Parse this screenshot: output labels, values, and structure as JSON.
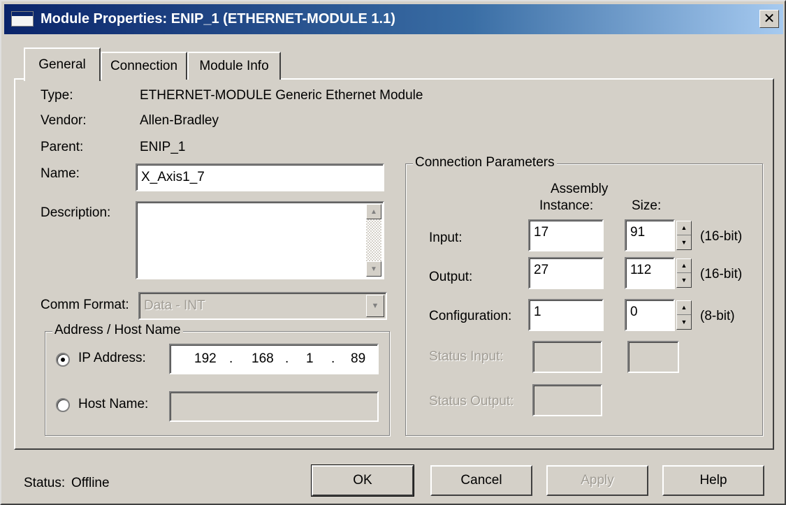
{
  "window": {
    "title": "Module Properties: ENIP_1 (ETHERNET-MODULE 1.1)",
    "close_glyph": "✕"
  },
  "tabs": [
    {
      "label": "General",
      "active": true
    },
    {
      "label": "Connection",
      "active": false
    },
    {
      "label": "Module Info",
      "active": false
    }
  ],
  "general": {
    "type_label": "Type:",
    "type_value": "ETHERNET-MODULE Generic Ethernet Module",
    "vendor_label": "Vendor:",
    "vendor_value": "Allen-Bradley",
    "parent_label": "Parent:",
    "parent_value": "ENIP_1",
    "name_label": "Name:",
    "name_value": "X_Axis1_7",
    "description_label": "Description:",
    "description_value": "",
    "comm_format_label": "Comm Format:",
    "comm_format_value": "Data - INT"
  },
  "address": {
    "group_title": "Address / Host Name",
    "ip_label": "IP Address:",
    "ip_octets": [
      "192",
      "168",
      "1",
      "89"
    ],
    "ip_dot": ".",
    "host_label": "Host Name:",
    "host_value": "",
    "selected": "ip"
  },
  "connection_params": {
    "group_title": "Connection Parameters",
    "col_assembly_line1": "Assembly",
    "col_assembly_line2": "Instance:",
    "col_size": "Size:",
    "rows": [
      {
        "label": "Input:",
        "instance": "17",
        "size": "91",
        "unit": "(16-bit)"
      },
      {
        "label": "Output:",
        "instance": "27",
        "size": "112",
        "unit": "(16-bit)"
      },
      {
        "label": "Configuration:",
        "instance": "1",
        "size": "0",
        "unit": "(8-bit)"
      }
    ],
    "status_input_label": "Status Input:",
    "status_output_label": "Status Output:"
  },
  "footer": {
    "status_label": "Status:",
    "status_value": "Offline",
    "ok_label": "OK",
    "cancel_label": "Cancel",
    "apply_label": "Apply",
    "help_label": "Help"
  }
}
